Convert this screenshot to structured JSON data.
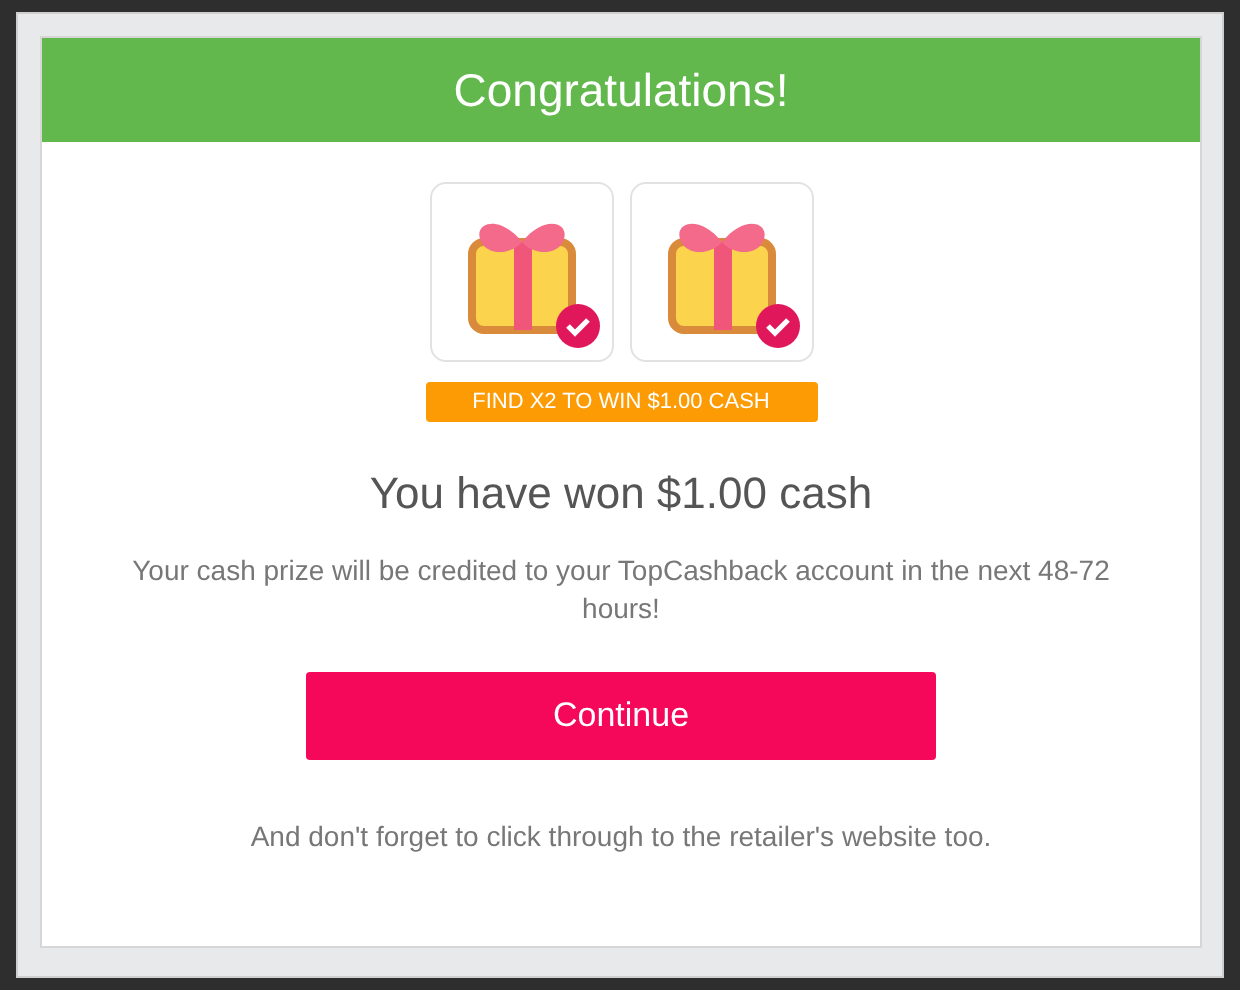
{
  "dialog": {
    "title": "Congratulations!",
    "gifts": [
      {
        "found": true
      },
      {
        "found": true
      }
    ],
    "badge": "FIND X2 TO WIN $1.00 CASH",
    "headline": "You have won $1.00 cash",
    "message": "Your cash prize will be credited to your TopCashback account in the next 48-72 hours!",
    "button": "Continue",
    "footer": "And don't forget to click through to the retailer's website too."
  }
}
